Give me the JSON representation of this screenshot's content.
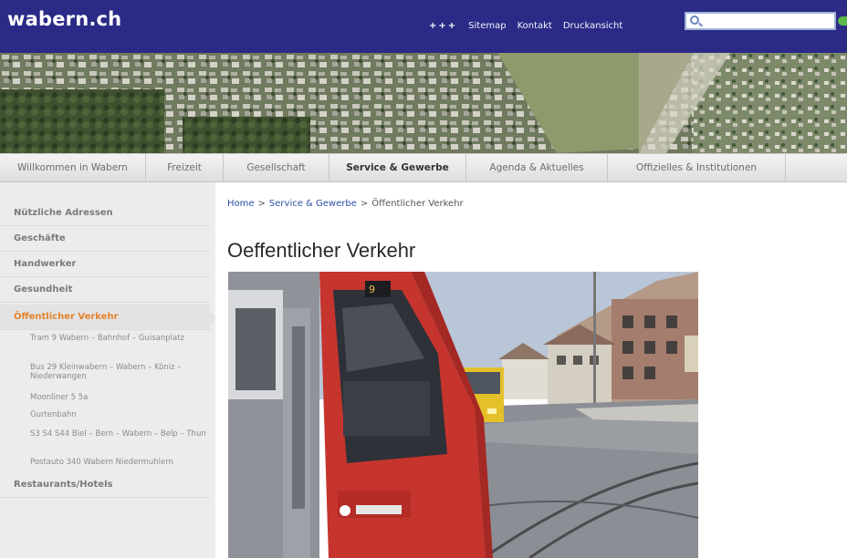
{
  "header": {
    "logo": "wabern.ch",
    "plus": "+++",
    "links": [
      "Sitemap",
      "Kontakt",
      "Druckansicht"
    ],
    "search_placeholder": ""
  },
  "mainnav": {
    "tabs": [
      {
        "label": "Willkommen in Wabern",
        "active": false
      },
      {
        "label": "Freizeit",
        "active": false
      },
      {
        "label": "Gesellschaft",
        "active": false
      },
      {
        "label": "Service & Gewerbe",
        "active": true
      },
      {
        "label": "Agenda & Aktuelles",
        "active": false
      },
      {
        "label": "Offizielles & Institutionen",
        "active": false
      }
    ]
  },
  "sidebar": {
    "items": [
      {
        "label": "Nützliche Adressen"
      },
      {
        "label": "Geschäfte"
      },
      {
        "label": "Handwerker"
      },
      {
        "label": "Gesundheit"
      },
      {
        "label": "Öffentlicher Verkehr"
      },
      {
        "label": "Restaurants/Hotels"
      }
    ],
    "subitems": [
      "Tram 9 Wabern – Bahnhof – Guisanplatz",
      "Bus 29 Kleinwabern – Wabern – Köniz – Niederwangen",
      "Moonliner 5 5a",
      "Gurtenbahn",
      "S3 S4 S44 Biel – Bern – Wabern – Belp – Thun",
      "Postauto 340 Wabern Niedermuhlern"
    ]
  },
  "content": {
    "breadcrumb": [
      "Home",
      ">",
      "Service & Gewerbe",
      ">",
      "Öffentlicher Verkehr"
    ],
    "title": "Oeffentlicher Verkehr",
    "photo_label": "tram-and-bus-street-photo"
  },
  "colors": {
    "header_bg": "#2b2a86",
    "active_side_text": "#e4822a",
    "link": "#2b4fa3"
  }
}
